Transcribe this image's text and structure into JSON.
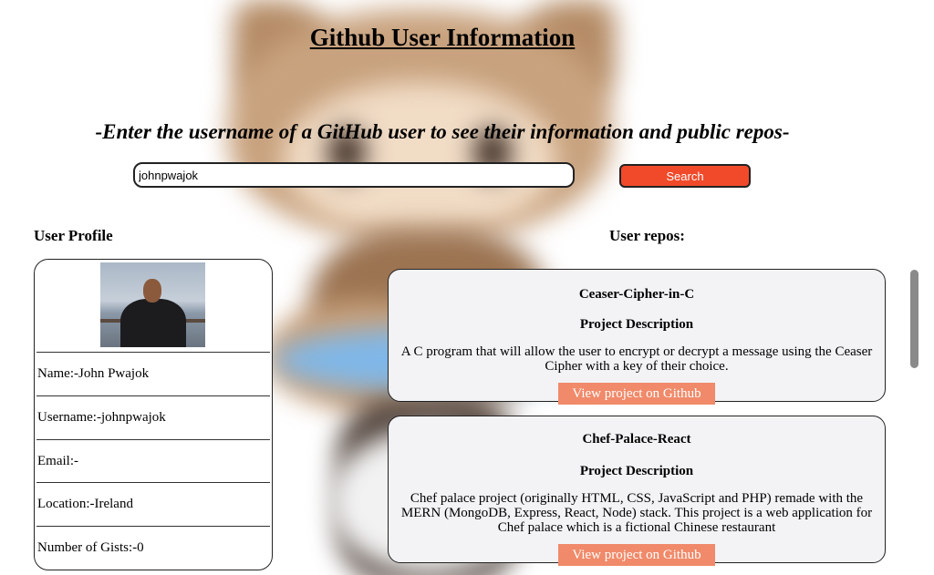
{
  "page": {
    "title": "Github User Information",
    "subtitle": "-Enter the username of a GitHub user to see their information and public repos-"
  },
  "search": {
    "value": "johnpwajok",
    "button_label": "Search"
  },
  "profile": {
    "heading": "User Profile",
    "name": "Name:-John Pwajok",
    "username": "Username:-johnpwajok",
    "email": "Email:-",
    "location": "Location:-Ireland",
    "gists": "Number of Gists:-0"
  },
  "repos": {
    "heading": "User repos:",
    "items": [
      {
        "name": "Ceaser-Cipher-in-C",
        "desc_heading": "Project Description",
        "description": "A C program that will allow the user to encrypt or decrypt a message using the Ceaser Cipher with a key of their choice.",
        "link_label": "View project on Github"
      },
      {
        "name": "Chef-Palace-React",
        "desc_heading": "Project Description",
        "description": "Chef palace project (originally HTML, CSS, JavaScript and PHP) remade with the MERN (MongoDB, Express, React, Node) stack. This project is a web application for Chef palace which is a fictional Chinese restaurant",
        "link_label": "View project on Github"
      }
    ]
  },
  "colors": {
    "search_button": "#f04a2a",
    "repo_link": "#f08a6a",
    "repo_card_bg": "#f3f3f6"
  }
}
